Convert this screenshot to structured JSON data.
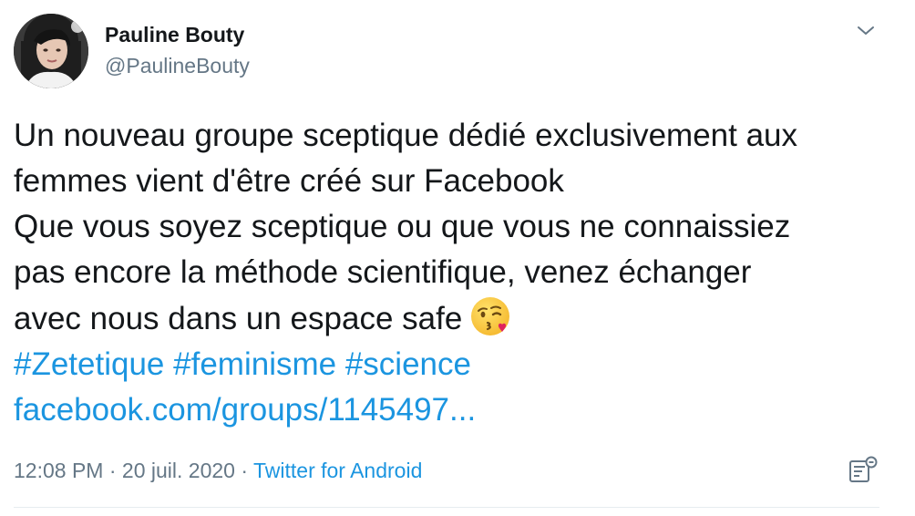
{
  "user": {
    "display_name": "Pauline Bouty",
    "handle": "@PaulineBouty"
  },
  "tweet": {
    "lines": [
      "Un nouveau groupe sceptique dédié exclusivement aux",
      "femmes vient d'être créé sur Facebook",
      "Que vous soyez sceptique ou que vous ne connaissiez",
      "pas encore la méthode scientifique, venez échanger",
      "avec nous dans un espace safe"
    ],
    "emoji": "face-throwing-kiss-emoji",
    "hashtags": [
      "#Zetetique",
      "#feminisme",
      "#science"
    ],
    "link": "facebook.com/groups/1145497..."
  },
  "meta": {
    "time": "12:08 PM",
    "separator": "·",
    "date": "20 juil. 2020",
    "source": "Twitter for Android"
  },
  "icons": {
    "menu": "chevron-down-icon",
    "analytics": "analytics-icon"
  },
  "colors": {
    "text": "#14171a",
    "secondary": "#657786",
    "link": "#1b95e0",
    "divider": "#e6ecf0"
  }
}
